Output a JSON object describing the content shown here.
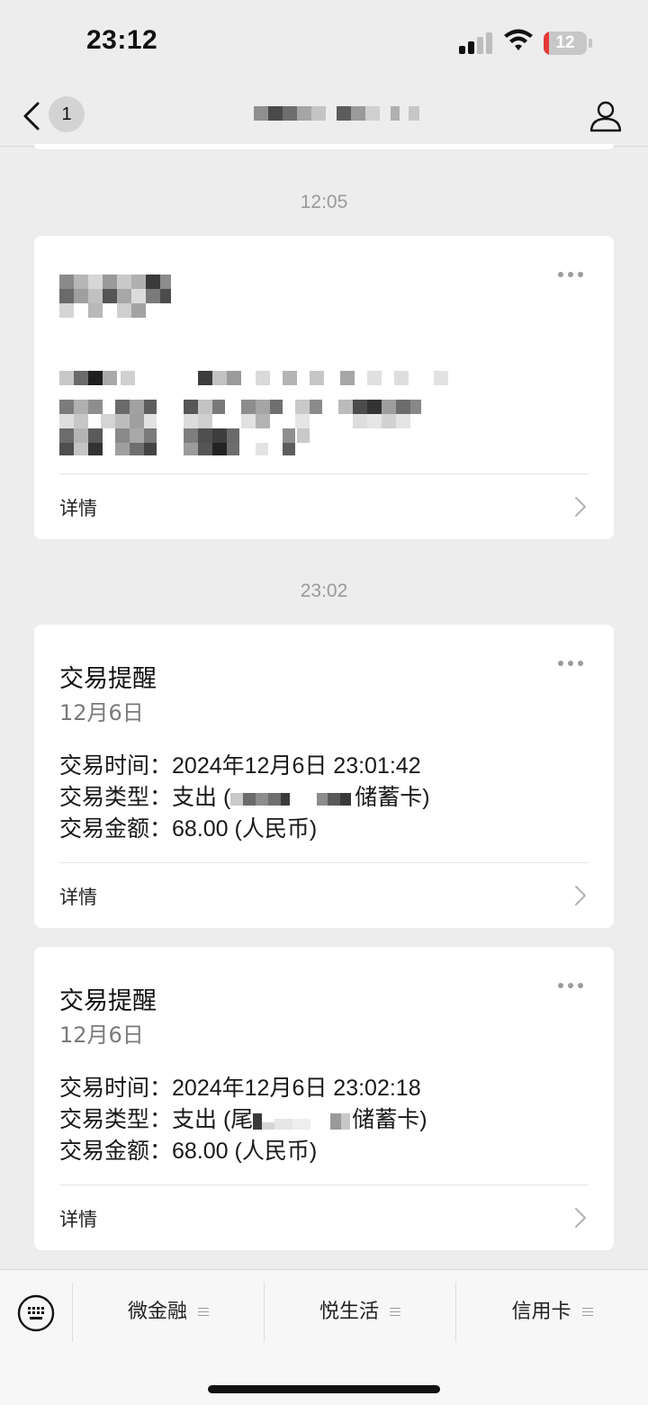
{
  "status_bar": {
    "time": "23:12",
    "battery": "12",
    "battery_level": 0.12,
    "battery_color": "#e53935",
    "icons": [
      "signal-icon",
      "wifi-icon",
      "battery-icon"
    ]
  },
  "nav": {
    "unread_count": "1",
    "icons": [
      "chevron-left-icon",
      "person-icon"
    ]
  },
  "timestamps": [
    "12:05",
    "23:02"
  ],
  "cards": [
    {
      "detail_label": "详情"
    },
    {
      "title": "交易提醒",
      "date": "12月6日",
      "rows": [
        {
          "label": "交易时间：",
          "value": "2024年12月6日 23:01:42"
        },
        {
          "label": "交易类型：",
          "value_prefix": "支出 (",
          "value_suffix": "储蓄卡)"
        },
        {
          "label": "交易金额：",
          "value": "68.00 (人民币)"
        }
      ],
      "detail_label": "详情"
    },
    {
      "title": "交易提醒",
      "date": "12月6日",
      "rows": [
        {
          "label": "交易时间：",
          "value": "2024年12月6日 23:02:18"
        },
        {
          "label": "交易类型：",
          "value_prefix": "支出 (尾",
          "value_suffix": "储蓄卡)"
        },
        {
          "label": "交易金额：",
          "value": "68.00 (人民币)"
        }
      ],
      "detail_label": "详情"
    }
  ],
  "bottom_menu": {
    "items": [
      "微金融",
      "悦生活",
      "信用卡"
    ],
    "icons": [
      "keyboard-icon",
      "menu-icon"
    ]
  }
}
